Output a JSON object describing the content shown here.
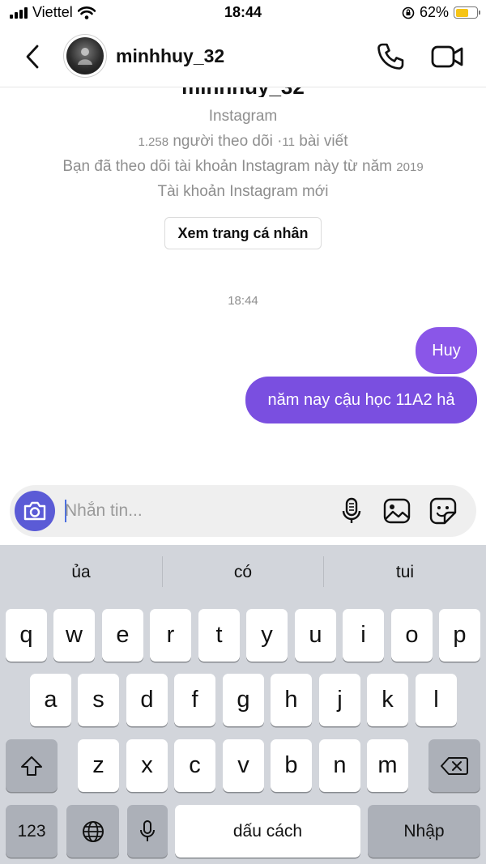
{
  "status_bar": {
    "carrier": "Viettel",
    "time": "18:44",
    "battery_percent": "62%",
    "battery_level": 0.62,
    "icons": [
      "signal-icon",
      "wifi-icon",
      "orientation-lock-icon",
      "battery-icon"
    ]
  },
  "header": {
    "username": "minhhuy_32",
    "icons": [
      "back-chevron-icon",
      "phone-icon",
      "video-camera-icon"
    ]
  },
  "profile": {
    "name_cut": "minhhuy_32",
    "platform": "Instagram",
    "followers_count": "1.258",
    "followers_label": "người theo dõi ·",
    "posts_count": "11",
    "posts_label": "bài viết",
    "following_since_label": "Bạn đã theo dõi tài khoản Instagram này từ năm",
    "following_since_year": "2019",
    "account_status": "Tài khoản Instagram mới",
    "view_profile_label": "Xem trang cá nhân"
  },
  "conversation": {
    "timestamp": "18:44",
    "messages": [
      {
        "text": "Huy",
        "sender": "me"
      },
      {
        "text": "năm nay cậu học 11A2 hả",
        "sender": "me"
      }
    ]
  },
  "composer": {
    "placeholder": "Nhắn tin...",
    "value": "",
    "icons": [
      "camera-icon",
      "microphone-icon",
      "image-icon",
      "sticker-icon"
    ]
  },
  "keyboard": {
    "suggestions": [
      "ủa",
      "có",
      "tui"
    ],
    "row1": [
      "q",
      "w",
      "e",
      "r",
      "t",
      "y",
      "u",
      "i",
      "o",
      "p"
    ],
    "row2": [
      "a",
      "s",
      "d",
      "f",
      "g",
      "h",
      "j",
      "k",
      "l"
    ],
    "row3": [
      "z",
      "x",
      "c",
      "v",
      "b",
      "n",
      "m"
    ],
    "numbers_key": "123",
    "space_key": "dấu cách",
    "return_key": "Nhập",
    "icons": [
      "shift-icon",
      "delete-icon",
      "globe-icon",
      "dictation-icon"
    ]
  },
  "colors": {
    "bubble_top": "#8a56e8",
    "bubble_bottom": "#7a4fe0",
    "camera_button": "#5b5bd6",
    "keyboard_bg": "#d2d5db",
    "battery": "#f6c416"
  }
}
